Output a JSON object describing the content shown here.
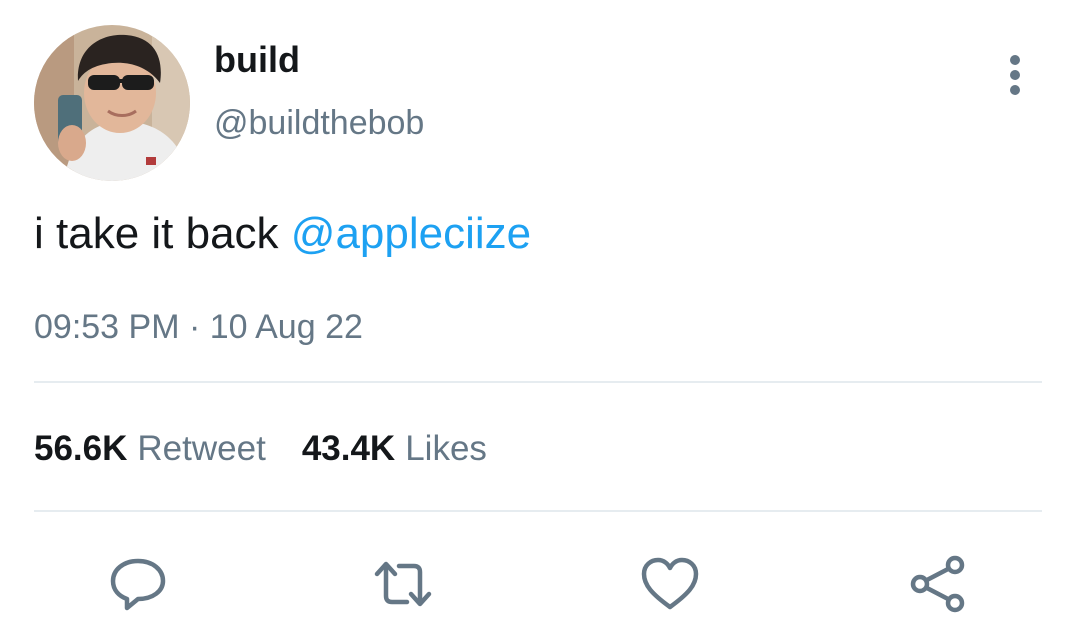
{
  "author": {
    "display_name": "build",
    "handle": "@buildthebob",
    "avatar_icon": "profile-photo"
  },
  "tweet": {
    "text": "i take it back ",
    "mention": "@appleciize",
    "timestamp": "09:53 PM · 10 Aug 22"
  },
  "stats": {
    "retweets_count": "56.6K",
    "retweets_label": "Retweet",
    "likes_count": "43.4K",
    "likes_label": "Likes"
  },
  "actions": {
    "reply_icon": "reply-icon",
    "retweet_icon": "retweet-icon",
    "like_icon": "heart-icon",
    "share_icon": "share-icon"
  },
  "colors": {
    "mention": "#1da1f2",
    "secondary_text": "#657786",
    "primary_text": "#14171a",
    "divider": "#e6ecf0"
  }
}
